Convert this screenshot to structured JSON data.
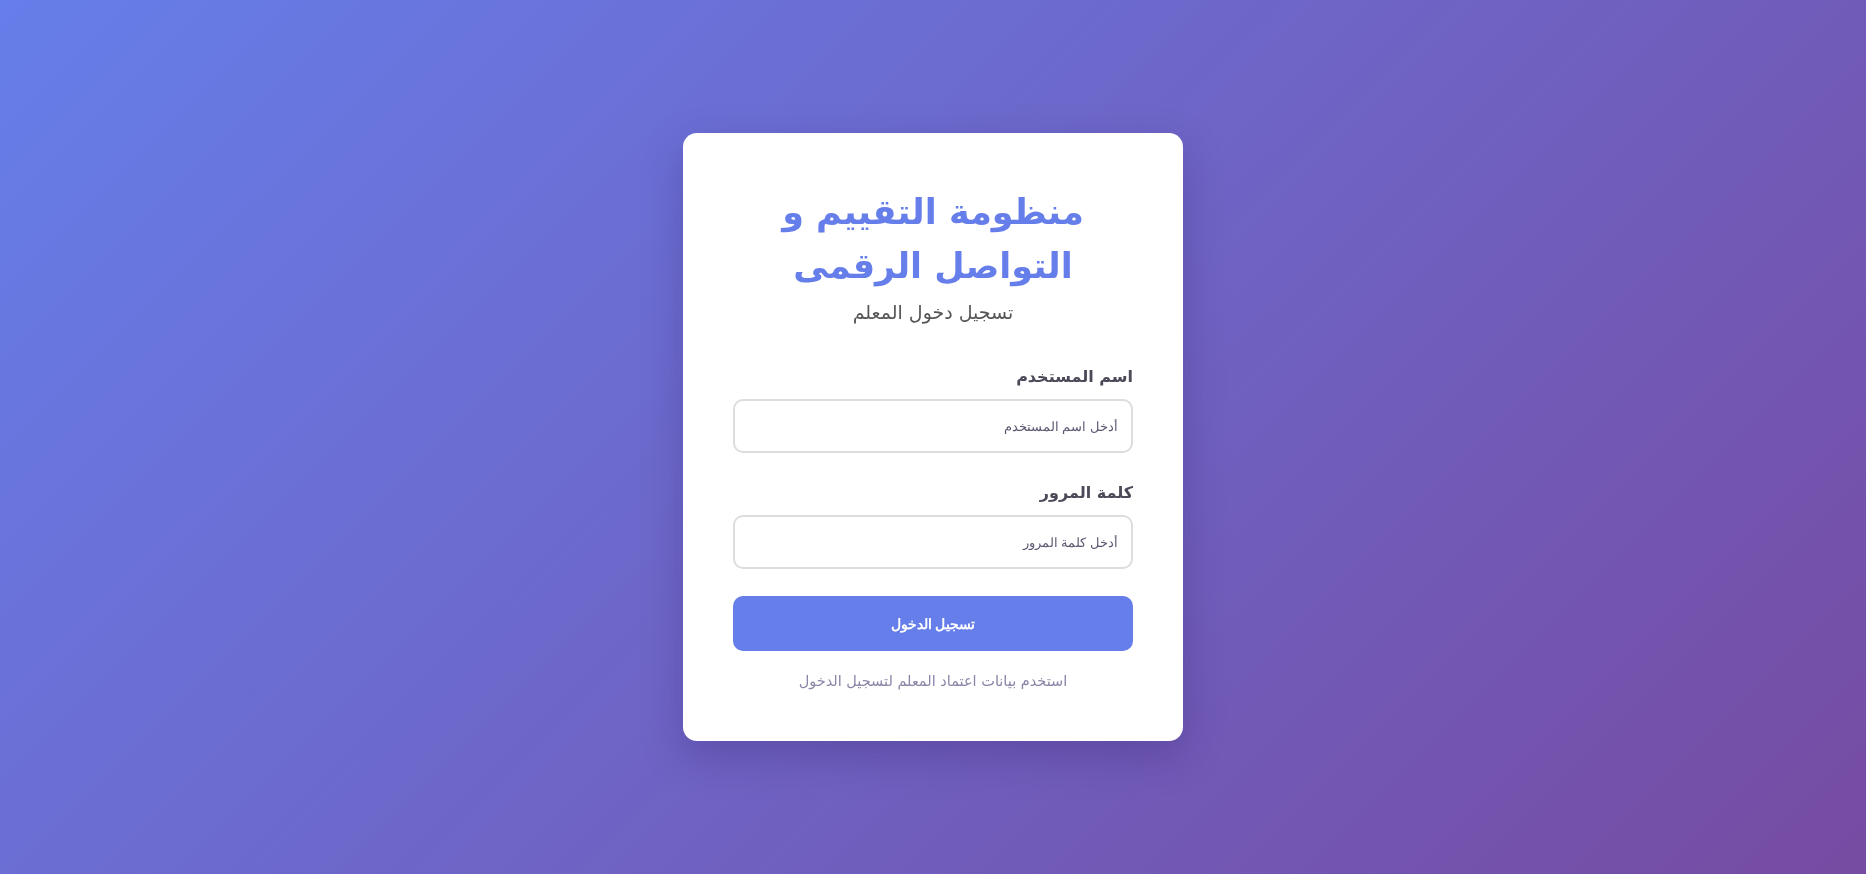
{
  "card": {
    "title": "منظومة التقييم و التواصل الرقمى",
    "subtitle": "تسجيل دخول المعلم"
  },
  "fields": [
    {
      "label": "اسم المستخدم",
      "placeholder": "أدخل اسم المستخدم"
    },
    {
      "label": "كلمة المرور",
      "placeholder": "أدخل كلمة المرور"
    }
  ],
  "button": {
    "label": "تسجيل الدخول"
  },
  "hint": "استخدم بيانات اعتماد المعلم لتسجيل الدخول"
}
